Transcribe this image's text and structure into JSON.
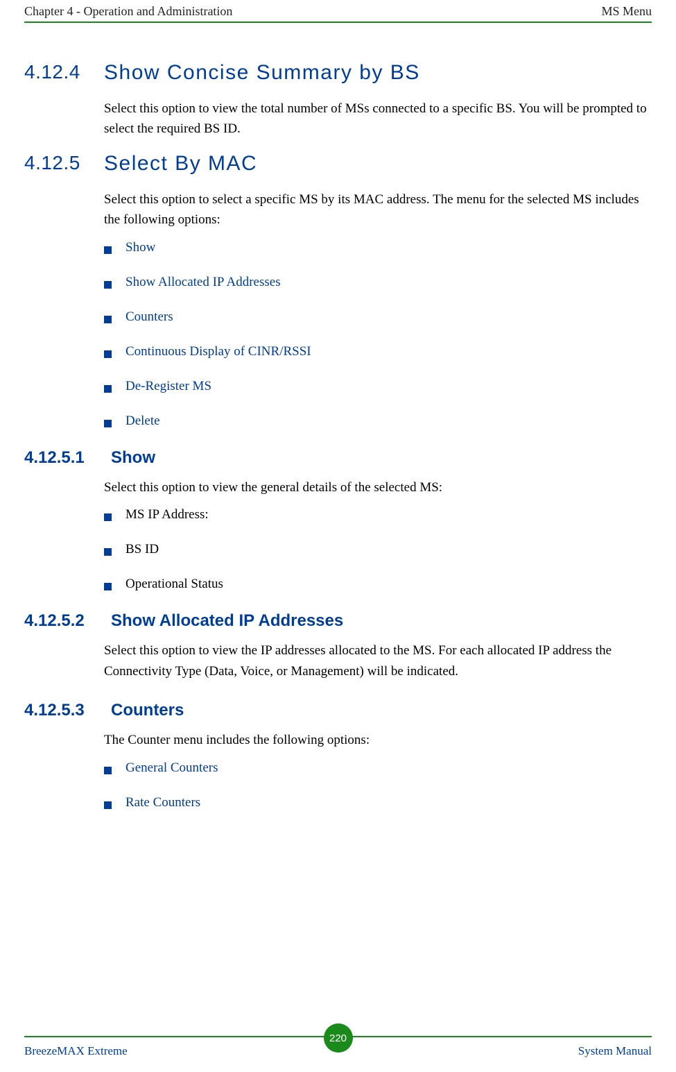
{
  "header": {
    "left": "Chapter 4 - Operation and Administration",
    "right": "MS Menu"
  },
  "sections": {
    "s1": {
      "num": "4.12.4",
      "title": "Show Concise Summary by BS",
      "p1": "Select this option to view the total number of MSs connected to a specific BS. You will be prompted to select the required BS ID."
    },
    "s2": {
      "num": "4.12.5",
      "title": "Select By MAC",
      "p1": "Select this option to select a specific MS by its MAC address. The menu for the selected MS includes the following options:",
      "bullets": {
        "b1": "Show",
        "b2": "Show Allocated IP Addresses",
        "b3": "Counters",
        "b4": "Continuous Display of CINR/RSSI",
        "b5": "De-Register MS",
        "b6": "Delete"
      }
    },
    "s3": {
      "num": "4.12.5.1",
      "title": "Show",
      "p1": "Select this option to view the general details of the selected MS:",
      "bullets": {
        "b1": "MS IP Address:",
        "b2": "BS ID",
        "b3": "Operational Status"
      }
    },
    "s4": {
      "num": "4.12.5.2",
      "title": "Show Allocated IP Addresses",
      "p1": "Select this option to view the IP addresses allocated to the MS. For each allocated IP address the Connectivity Type (Data, Voice, or Management) will be indicated."
    },
    "s5": {
      "num": "4.12.5.3",
      "title": "Counters",
      "p1": "The Counter menu includes the following options:",
      "bullets": {
        "b1": "General Counters",
        "b2": "Rate Counters"
      }
    }
  },
  "footer": {
    "left": "BreezeMAX Extreme",
    "page": "220",
    "right": "System Manual"
  }
}
